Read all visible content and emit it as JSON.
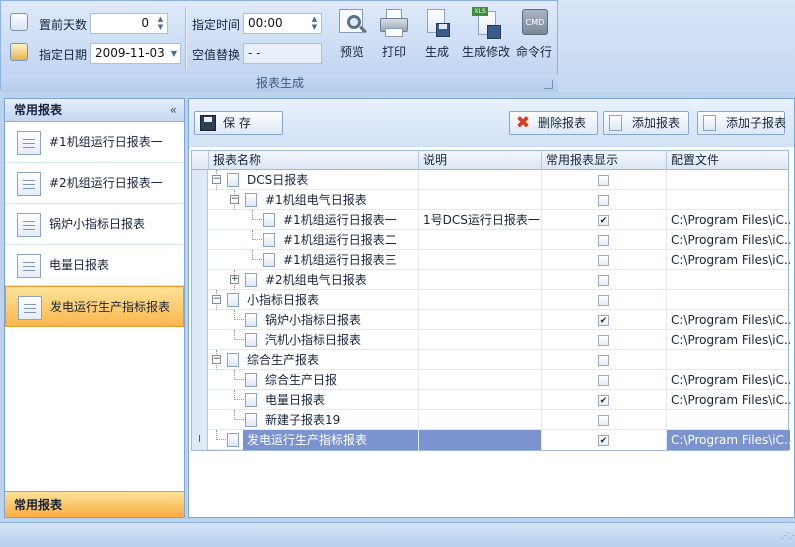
{
  "ribbon": {
    "days_label": "置前天数",
    "days_value": "0",
    "date_label": "指定日期",
    "date_value": "2009-11-03",
    "time_label": "指定时间",
    "time_value": "00:00",
    "null_label": "空值替换",
    "null_value": "- -",
    "buttons": {
      "preview": "预览",
      "print": "打印",
      "generate": "生成",
      "generate_modify": "生成修改",
      "cmd": "命令行",
      "cmd_icon_text": "CMD",
      "xls_icon_text": "XLS"
    },
    "group_title": "报表生成"
  },
  "left_panel": {
    "title": "常用报表",
    "collapse_glyph": "«",
    "items": [
      {
        "label": "#1机组运行日报表一"
      },
      {
        "label": "#2机组运行日报表一"
      },
      {
        "label": "锅炉小指标日报表"
      },
      {
        "label": "电量日报表"
      },
      {
        "label": "发电运行生产指标报表"
      }
    ],
    "footer": "常用报表"
  },
  "toolbar": {
    "save": "保  存",
    "delete": "删除报表",
    "add": "添加报表",
    "add_child": "添加子报表"
  },
  "grid": {
    "columns": [
      "报表名称",
      "说明",
      "常用报表显示",
      "配置文件"
    ],
    "rows": [
      {
        "name": "DCS日报表",
        "desc": "",
        "checked": false,
        "config": "",
        "level": 0,
        "expand": "−"
      },
      {
        "name": "#1机组电气日报表",
        "desc": "",
        "checked": false,
        "config": "",
        "level": 1,
        "expand": "−"
      },
      {
        "name": "#1机组运行日报表一",
        "desc": "1号DCS运行日报表一",
        "checked": true,
        "config": "C:\\Program Files\\iC...",
        "level": 2,
        "expand": ""
      },
      {
        "name": "#1机组运行日报表二",
        "desc": "",
        "checked": false,
        "config": "C:\\Program Files\\iC...",
        "level": 2,
        "expand": ""
      },
      {
        "name": "#1机组运行日报表三",
        "desc": "",
        "checked": false,
        "config": "C:\\Program Files\\iC...",
        "level": 2,
        "expand": ""
      },
      {
        "name": "#2机组电气日报表",
        "desc": "",
        "checked": false,
        "config": "",
        "level": 1,
        "expand": "+"
      },
      {
        "name": "小指标日报表",
        "desc": "",
        "checked": false,
        "config": "",
        "level": 0,
        "expand": "−"
      },
      {
        "name": "锅炉小指标日报表",
        "desc": "",
        "checked": true,
        "config": "C:\\Program Files\\iC...",
        "level": 1,
        "expand": ""
      },
      {
        "name": "汽机小指标日报表",
        "desc": "",
        "checked": false,
        "config": "C:\\Program Files\\iC...",
        "level": 1,
        "expand": ""
      },
      {
        "name": "综合生产报表",
        "desc": "",
        "checked": false,
        "config": "",
        "level": 0,
        "expand": "−"
      },
      {
        "name": "综合生产日报",
        "desc": "",
        "checked": false,
        "config": "C:\\Program Files\\iC...",
        "level": 1,
        "expand": ""
      },
      {
        "name": "电量日报表",
        "desc": "",
        "checked": true,
        "config": "C:\\Program Files\\iC...",
        "level": 1,
        "expand": ""
      },
      {
        "name": "新建子报表19",
        "desc": "",
        "checked": false,
        "config": "",
        "level": 1,
        "expand": ""
      },
      {
        "name": "发电运行生产指标报表",
        "desc": "",
        "checked": true,
        "config": "C:\\Program Files\\iC...",
        "level": 0,
        "expand": "",
        "selected": true
      }
    ]
  },
  "colors": {
    "accent_selected": "#7b93cf",
    "nav_selected": "#fbb64c"
  }
}
